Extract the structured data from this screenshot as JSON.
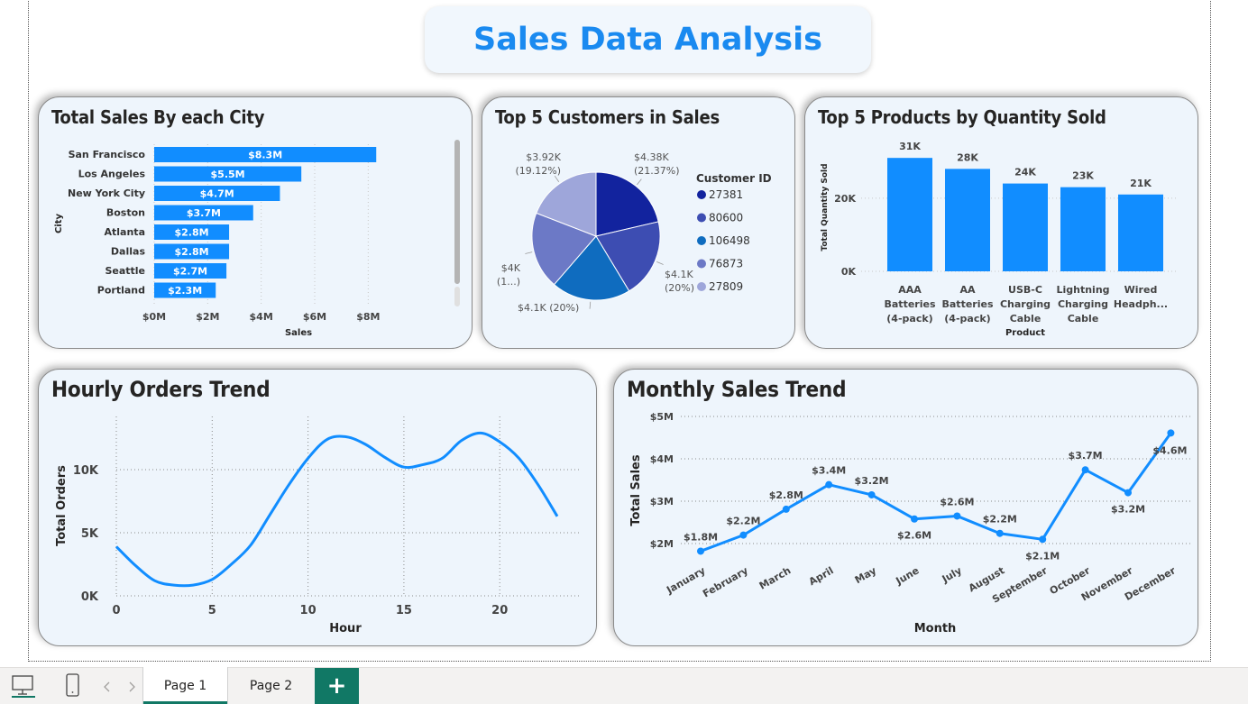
{
  "dashboard": {
    "title": "Sales Data Analysis"
  },
  "city_sales": {
    "title": "Total Sales By each City",
    "chart_data": {
      "type": "bar",
      "orientation": "horizontal",
      "categories": [
        "San Francisco",
        "Los Angeles",
        "New York City",
        "Boston",
        "Atlanta",
        "Dallas",
        "Seattle",
        "Portland"
      ],
      "values": [
        8.3,
        5.5,
        4.7,
        3.7,
        2.8,
        2.8,
        2.7,
        2.3
      ],
      "data_labels": [
        "$8.3M",
        "$5.5M",
        "$4.7M",
        "$3.7M",
        "$2.8M",
        "$2.8M",
        "$2.7M",
        "$2.3M"
      ],
      "xlabel": "Sales",
      "ylabel": "City",
      "xlim": [
        0,
        9
      ],
      "xticks": [
        0,
        2,
        4,
        6,
        8
      ],
      "xtick_labels": [
        "$0M",
        "$2M",
        "$4M",
        "$6M",
        "$8M"
      ],
      "bar_color": "#118dff",
      "grid": "vertical dotted"
    }
  },
  "customers": {
    "title": "Top 5 Customers in Sales",
    "chart_data": {
      "type": "pie",
      "legend_title": "Customer ID",
      "legend_position": "right",
      "slices": [
        {
          "label": "27381",
          "value": 4.38,
          "data_label": "$4.38K (21.37%)",
          "color": "#12239e"
        },
        {
          "label": "80600",
          "value": 4.1,
          "data_label": "$4.1K (20%)",
          "color": "#3d4db2"
        },
        {
          "label": "106498",
          "value": 4.1,
          "data_label": "$4.1K (20%)",
          "color": "#0f6cbf"
        },
        {
          "label": "76873",
          "value": 4.0,
          "data_label": "$4K (1...)",
          "color": "#6c79c6"
        },
        {
          "label": "27809",
          "value": 3.92,
          "data_label": "$3.92K (19.12%)",
          "color": "#9ea6da"
        }
      ]
    }
  },
  "products": {
    "title": "Top 5 Products by Quantity Sold",
    "chart_data": {
      "type": "bar",
      "orientation": "vertical",
      "categories": [
        "AAA Batteries (4-pack)",
        "AA Batteries (4-pack)",
        "USB-C Charging Cable",
        "Lightning Charging Cable",
        "Wired Headph..."
      ],
      "category_lines": [
        [
          "AAA",
          "Batteries",
          "(4-pack)"
        ],
        [
          "AA",
          "Batteries",
          "(4-pack)"
        ],
        [
          "USB-C",
          "Charging",
          "Cable"
        ],
        [
          "Lightning",
          "Charging",
          "Cable"
        ],
        [
          "Wired",
          "Headph..."
        ]
      ],
      "values": [
        31,
        28,
        24,
        23,
        21
      ],
      "data_labels": [
        "31K",
        "28K",
        "24K",
        "23K",
        "21K"
      ],
      "xlabel": "Product",
      "ylabel": "Total Quantity Sold",
      "ylim": [
        0,
        34
      ],
      "yticks": [
        0,
        20
      ],
      "ytick_labels": [
        "0K",
        "20K"
      ],
      "bar_color": "#118dff"
    }
  },
  "hourly": {
    "title": "Hourly Orders Trend",
    "chart_data": {
      "type": "line",
      "x": [
        0,
        1,
        2,
        3,
        4,
        5,
        6,
        7,
        8,
        9,
        10,
        11,
        12,
        13,
        14,
        15,
        16,
        17,
        18,
        19,
        20,
        21,
        22,
        23
      ],
      "values": [
        3.9,
        2.4,
        1.2,
        0.85,
        0.85,
        1.3,
        2.5,
        4.0,
        6.4,
        8.8,
        10.9,
        12.4,
        12.6,
        12.0,
        10.98,
        10.2,
        10.4,
        10.9,
        12.3,
        12.9,
        12.2,
        10.9,
        8.8,
        6.3
      ],
      "xlabel": "Hour",
      "ylabel": "Total Orders",
      "xlim": [
        0,
        23
      ],
      "ylim": [
        0,
        14
      ],
      "xticks": [
        0,
        5,
        10,
        15,
        20
      ],
      "yticks": [
        0,
        5,
        10
      ],
      "ytick_labels": [
        "0K",
        "5K",
        "10K"
      ],
      "line_color": "#118dff",
      "grid": "dotted"
    }
  },
  "monthly": {
    "title": "Monthly Sales Trend",
    "chart_data": {
      "type": "line",
      "categories": [
        "January",
        "February",
        "March",
        "April",
        "May",
        "June",
        "July",
        "August",
        "September",
        "October",
        "November",
        "December"
      ],
      "values": [
        1.82,
        2.2,
        2.81,
        3.39,
        3.15,
        2.58,
        2.65,
        2.24,
        2.1,
        3.74,
        3.2,
        4.61
      ],
      "data_labels": [
        "$1.8M",
        "$2.2M",
        "$2.8M",
        "$3.4M",
        "$3.2M",
        "$2.6M",
        "$2.6M",
        "$2.2M",
        "$2.1M",
        "$3.7M",
        "$3.2M",
        "$4.6M"
      ],
      "xlabel": "Month",
      "ylabel": "Total Sales",
      "ylim": [
        1.5,
        5.2
      ],
      "yticks": [
        2,
        3,
        4,
        5
      ],
      "ytick_labels": [
        "$2M",
        "$3M",
        "$4M",
        "$5M"
      ],
      "line_color": "#118dff",
      "grid": "dotted"
    }
  },
  "footer": {
    "tabs": [
      {
        "label": "Page 1",
        "active": true
      },
      {
        "label": "Page 2",
        "active": false
      }
    ],
    "add_label": "+",
    "icons": [
      "desktop-view-icon",
      "mobile-view-icon",
      "prev-page-icon",
      "next-page-icon"
    ]
  }
}
